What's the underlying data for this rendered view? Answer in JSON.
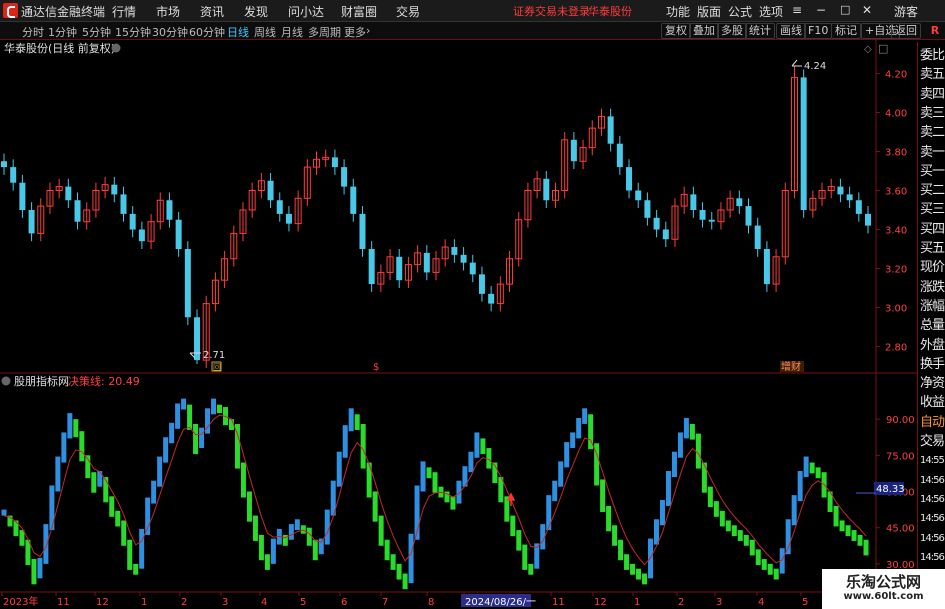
{
  "app": {
    "title": "通达信金融终端"
  },
  "menu": {
    "items": [
      "行情",
      "市场",
      "资讯",
      "发现",
      "问小达",
      "财富圈",
      "交易"
    ],
    "login_warning": "证券交易未登录",
    "stock_name": "华泰股份",
    "right_items": [
      "功能",
      "版面",
      "公式",
      "选项"
    ],
    "guest": "游客"
  },
  "toolbar": {
    "periods": [
      "分时",
      "1分钟",
      "5分钟",
      "15分钟",
      "30分钟",
      "60分钟",
      "日线",
      "周线",
      "月线",
      "多周期",
      "更多"
    ],
    "active_period": "日线",
    "buttons": [
      "复权",
      "叠加",
      "多股",
      "统计",
      "画线",
      "F10",
      "标记",
      "+自选",
      "返回"
    ],
    "corner": "R"
  },
  "main_chart": {
    "title": "华泰股份(日线 前复权)",
    "y_ticks": [
      "4.20",
      "4.00",
      "3.80",
      "3.60",
      "3.40",
      "3.20",
      "3.00",
      "2.80"
    ],
    "high_label": "4.24",
    "low_label": "2.71",
    "event_markers": [
      "回",
      "$",
      "增财"
    ]
  },
  "indicator": {
    "name": "股朋指标网",
    "line_label": "决策线: 20.49",
    "y_ticks": [
      "90.00",
      "75.00",
      "60.00",
      "45.00",
      "30.00"
    ],
    "current_value": "48.33"
  },
  "x_axis": {
    "labels": [
      "2023年",
      "11",
      "12",
      "1",
      "2",
      "3",
      "4",
      "5",
      "6",
      "7",
      "8",
      "2024/08/26/一",
      "11",
      "12",
      "1",
      "2",
      "3",
      "4",
      "5"
    ]
  },
  "sidebar": {
    "items": [
      "委比",
      "卖五",
      "卖四",
      "卖三",
      "卖二",
      "卖一",
      "买一",
      "买二",
      "买三",
      "买四",
      "买五",
      "现价",
      "涨跌",
      "涨幅",
      "总量",
      "外盘",
      "换手",
      "净资",
      "收益",
      "自动",
      "交易",
      "14:55",
      "14:56",
      "14:56",
      "14:56",
      "14:56",
      "14:56",
      "14:56",
      "14:56",
      "14:56"
    ]
  },
  "watermark": {
    "line1": "乐淘公式网",
    "line2": "www.60lt.com"
  },
  "chart_data": [
    {
      "type": "candlestick",
      "title": "华泰股份(日线 前复权)",
      "ylim": [
        2.7,
        4.3
      ],
      "annotations": {
        "high": 4.24,
        "low": 2.71
      },
      "close": [
        3.72,
        3.64,
        3.5,
        3.38,
        3.52,
        3.6,
        3.62,
        3.55,
        3.44,
        3.5,
        3.6,
        3.63,
        3.58,
        3.48,
        3.4,
        3.34,
        3.44,
        3.55,
        3.45,
        3.3,
        2.95,
        2.73,
        3.02,
        3.14,
        3.25,
        3.38,
        3.5,
        3.6,
        3.65,
        3.55,
        3.48,
        3.43,
        3.56,
        3.72,
        3.76,
        3.77,
        3.72,
        3.62,
        3.48,
        3.3,
        3.12,
        3.18,
        3.26,
        3.14,
        3.22,
        3.28,
        3.18,
        3.25,
        3.31,
        3.27,
        3.23,
        3.17,
        3.07,
        3.02,
        3.12,
        3.25,
        3.45,
        3.6,
        3.66,
        3.55,
        3.6,
        3.86,
        3.75,
        3.82,
        3.92,
        3.98,
        3.84,
        3.72,
        3.6,
        3.55,
        3.46,
        3.4,
        3.35,
        3.52,
        3.58,
        3.5,
        3.45,
        3.44,
        3.5,
        3.56,
        3.52,
        3.42,
        3.3,
        3.12,
        3.26,
        3.6,
        4.18,
        3.5,
        3.56,
        3.6,
        3.62,
        3.58,
        3.55,
        3.48,
        3.42
      ]
    },
    {
      "type": "line",
      "name": "股朋指标网",
      "ylim": [
        20,
        100
      ],
      "series": [
        {
          "name": "决策线",
          "color": "#c62828",
          "values": [
            50,
            48,
            44,
            40,
            32,
            24,
            30,
            44,
            60,
            72,
            82,
            90,
            85,
            75,
            68,
            62,
            66,
            58,
            52,
            48,
            40,
            30,
            28,
            42,
            55,
            62,
            72,
            80,
            86,
            94,
            96,
            88,
            78,
            84,
            92,
            96,
            95,
            90,
            88,
            72,
            60,
            50,
            42,
            34,
            30,
            38,
            42,
            40,
            44,
            46,
            45,
            40,
            34,
            38,
            50,
            62,
            74,
            85,
            92,
            88,
            72,
            60,
            50,
            40,
            34,
            30,
            26,
            22,
            40,
            60,
            70,
            68,
            62,
            60,
            58,
            55,
            62,
            68,
            74,
            82,
            78,
            72,
            66,
            58,
            50,
            44,
            38,
            30,
            28,
            36,
            44,
            56,
            62,
            70,
            78,
            82,
            88,
            92,
            80,
            65,
            54,
            46,
            40,
            34,
            30,
            28,
            26,
            24,
            38,
            46,
            54,
            66,
            74,
            82,
            88,
            84,
            72,
            62,
            56,
            52,
            48,
            46,
            44,
            42,
            40,
            36,
            32,
            30,
            28,
            26,
            34,
            46,
            56,
            66,
            72,
            70,
            68,
            60,
            54,
            48,
            46,
            44,
            42,
            40,
            36
          ]
        }
      ]
    }
  ]
}
